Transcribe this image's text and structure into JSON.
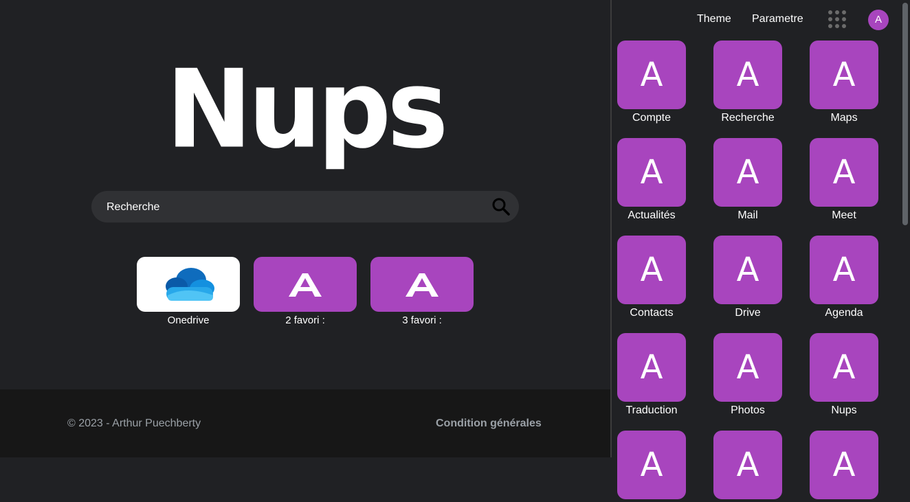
{
  "logo": {
    "text": "Nups"
  },
  "search": {
    "placeholder": "Recherche"
  },
  "favorites": [
    {
      "label": "Onedrive",
      "icon": "onedrive-cloud-icon",
      "bg": "#ffffff"
    },
    {
      "label": "2 favori :",
      "icon": "a-letter-icon",
      "bg": "#a845be"
    },
    {
      "label": "3 favori :",
      "icon": "a-letter-icon",
      "bg": "#a845be"
    }
  ],
  "footer": {
    "copyright": "© 2023 - Arthur Puechberty",
    "conditions": "Condition générales"
  },
  "topnav": {
    "theme": "Theme",
    "settings": "Parametre",
    "avatar_letter": "A"
  },
  "apps": [
    {
      "label": "Compte",
      "letter": "A"
    },
    {
      "label": "Recherche",
      "letter": "A"
    },
    {
      "label": "Maps",
      "letter": "A"
    },
    {
      "label": "Actualités",
      "letter": "A"
    },
    {
      "label": "Mail",
      "letter": "A"
    },
    {
      "label": "Meet",
      "letter": "A"
    },
    {
      "label": "Contacts",
      "letter": "A"
    },
    {
      "label": "Drive",
      "letter": "A"
    },
    {
      "label": "Agenda",
      "letter": "A"
    },
    {
      "label": "Traduction",
      "letter": "A"
    },
    {
      "label": "Photos",
      "letter": "A"
    },
    {
      "label": "Nups",
      "letter": "A"
    },
    {
      "label": "",
      "letter": "A"
    },
    {
      "label": "",
      "letter": "A"
    },
    {
      "label": "",
      "letter": "A"
    }
  ],
  "colors": {
    "background": "#202124",
    "accent": "#a845be",
    "footer": "#171717",
    "search": "#303134"
  }
}
